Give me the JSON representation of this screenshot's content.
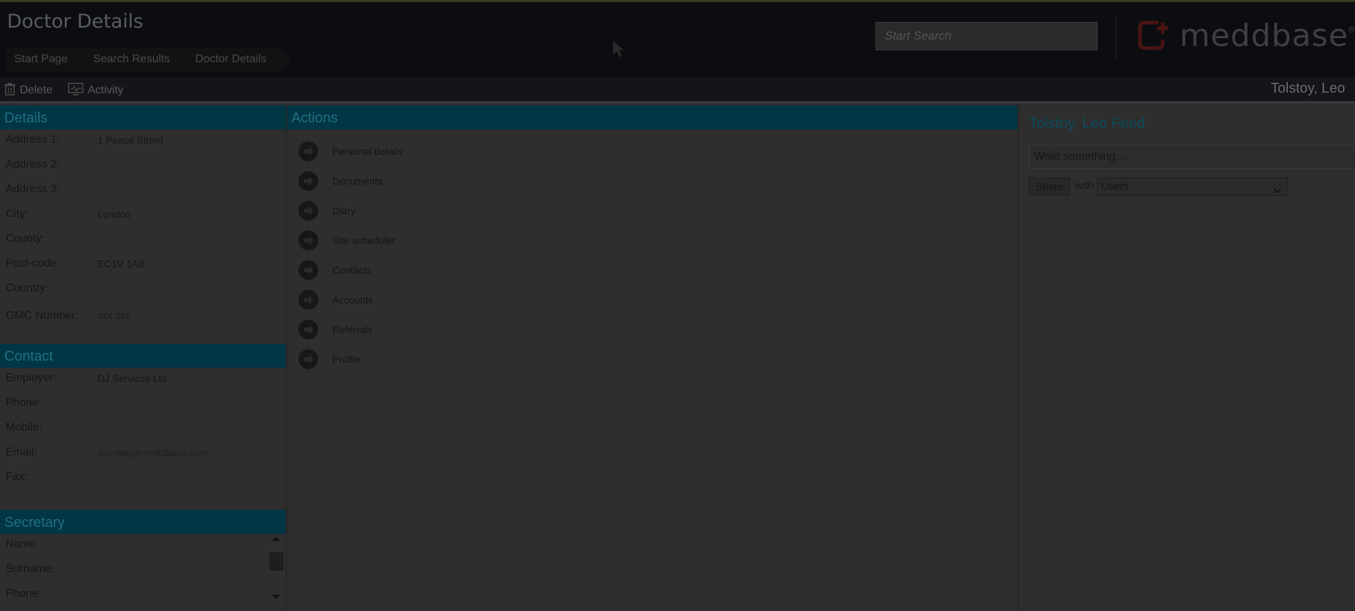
{
  "header": {
    "title": "Doctor Details",
    "breadcrumb": [
      "Start Page",
      "Search Results",
      "Doctor Details"
    ],
    "search_placeholder": "Start Search",
    "logo_text": "meddbase",
    "logo_reg": "®"
  },
  "toolbar": {
    "delete_label": "Delete",
    "activity_label": "Activity",
    "user_name": "Tolstoy, Leo"
  },
  "details": {
    "heading": "Details",
    "fields": [
      {
        "label": "Address 1:",
        "value": "1 Peace Street"
      },
      {
        "label": "Address 2:",
        "value": ""
      },
      {
        "label": "Address 3:",
        "value": ""
      },
      {
        "label": "City:",
        "value": "London"
      },
      {
        "label": "County:",
        "value": ""
      },
      {
        "label": "Post-code:",
        "value": "EC1V 1AB"
      },
      {
        "label": "Country:",
        "value": ""
      }
    ],
    "gmc_label": "GMC Number:",
    "gmc_value": "not set"
  },
  "contact": {
    "heading": "Contact",
    "fields": [
      {
        "label": "Employer:",
        "value": "DJ Services Ltd"
      },
      {
        "label": "Phone:",
        "value": ""
      },
      {
        "label": "Mobile:",
        "value": ""
      },
      {
        "label": "Email:",
        "value": "djordan@meddbase.com"
      },
      {
        "label": "Fax:",
        "value": ""
      }
    ]
  },
  "secretary": {
    "heading": "Secretary",
    "fields": [
      {
        "label": "Name:"
      },
      {
        "label": "Surname:"
      },
      {
        "label": "Phone:"
      }
    ]
  },
  "actions": {
    "heading": "Actions",
    "items": [
      "Personal details",
      "Documents",
      "Diary",
      "Site scheduler",
      "Contacts",
      "Accounts",
      "Referrals",
      "Profile"
    ]
  },
  "feed": {
    "title": "Tolstoy, Leo Feed",
    "input_placeholder": "Write something...",
    "share_label": "Share",
    "with_label": "with",
    "audience_selected": "Users"
  },
  "colors": {
    "section_header_bg": "#013644",
    "section_header_text": "#207083",
    "logo_accent": "#4a1412"
  },
  "icons": [
    "trash-icon",
    "activity-monitor-icon",
    "arrow-right-icon",
    "chevron-down-icon",
    "meddbase-logo-icon",
    "mouse-cursor-icon"
  ]
}
